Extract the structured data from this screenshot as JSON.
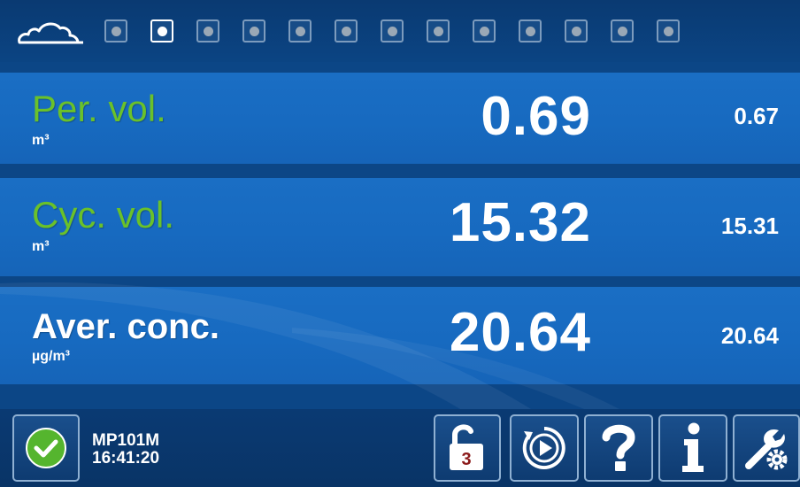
{
  "header": {
    "logo_icon": "cloud-icon",
    "page_count": 13,
    "active_page": 2
  },
  "rows": [
    {
      "label": "Per. vol.",
      "unit": "m³",
      "value": "0.69",
      "previous": "0.67",
      "label_color": "#6ac12a"
    },
    {
      "label": "Cyc. vol.",
      "unit": "m³",
      "value": "15.32",
      "previous": "15.31",
      "label_color": "#6ac12a"
    },
    {
      "label": "Aver. conc.",
      "unit": "µg/m³",
      "value": "20.64",
      "previous": "20.64",
      "label_color": "#ffffff"
    }
  ],
  "footer": {
    "status_icon": "check-circle-icon",
    "status_color": "#55b52e",
    "device": "MP101M",
    "time": "16:41:20",
    "lock_badge": "3",
    "buttons": [
      "lock-open-icon",
      "play-icon",
      "help-icon",
      "info-icon",
      "settings-icon"
    ]
  },
  "colors": {
    "background": "#0b3f7a",
    "band": "#176ac0",
    "accent_green": "#6ac12a"
  }
}
